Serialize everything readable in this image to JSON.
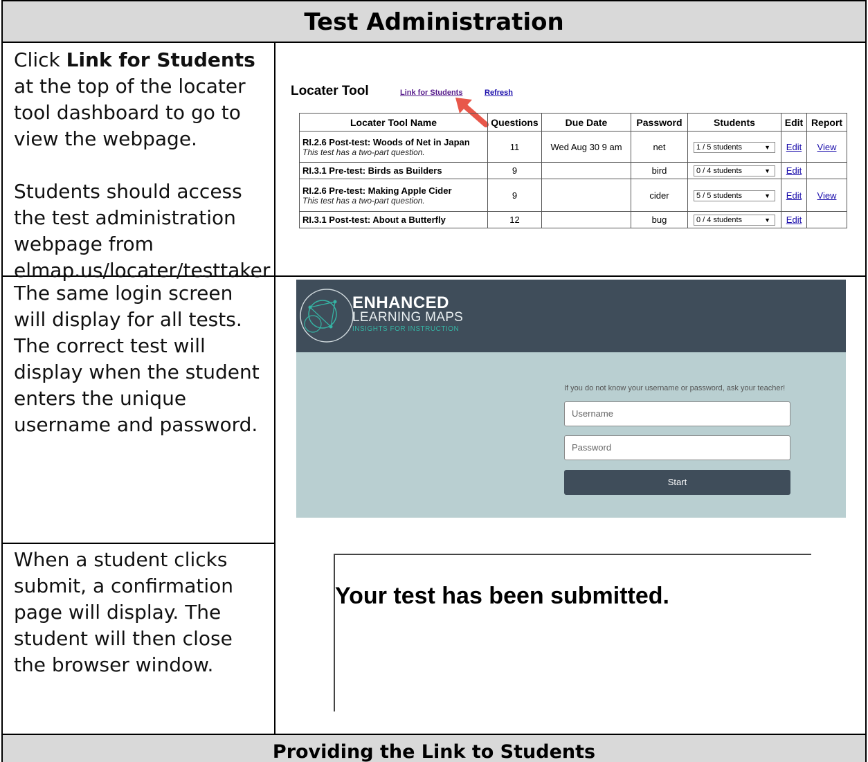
{
  "header": {
    "title": "Test Administration"
  },
  "footer": {
    "title": "Providing the Link to Students"
  },
  "row1": {
    "click_prefix": "Click ",
    "link_bold": "Link for Students",
    "text_a": "at the top of the locater tool dashboard to go to view the webpage.",
    "text_b": "Students should access the test administration webpage from elmap.us/locater/testtaker"
  },
  "locater": {
    "title": "Locater Tool",
    "link_students": "Link for Students",
    "link_refresh": "Refresh",
    "columns": [
      "Locater Tool Name",
      "Questions",
      "Due Date",
      "Password",
      "Students",
      "Edit",
      "Report"
    ],
    "rows": [
      {
        "name": "RI.2.6 Post-test: Woods of Net in Japan",
        "note": "This test has a two-part question.",
        "questions": "11",
        "due": "Wed Aug 30   9 am",
        "password": "net",
        "students": "1 / 5 students",
        "edit": "Edit",
        "report": "View"
      },
      {
        "name": "RI.3.1 Pre-test: Birds as Builders",
        "note": "",
        "questions": "9",
        "due": "",
        "password": "bird",
        "students": "0 / 4 students",
        "edit": "Edit",
        "report": ""
      },
      {
        "name": "RI.2.6 Pre-test: Making Apple Cider",
        "note": "This test has a two-part question.",
        "questions": "9",
        "due": "",
        "password": "cider",
        "students": "5 / 5 students",
        "edit": "Edit",
        "report": "View"
      },
      {
        "name": "RI.3.1 Post-test: About a Butterfly",
        "note": "",
        "questions": "12",
        "due": "",
        "password": "bug",
        "students": "0 / 4 students",
        "edit": "Edit",
        "report": ""
      }
    ],
    "arrow_color": "#e8574a"
  },
  "row2": {
    "text": "The same login screen will display for all tests. The correct test will display when the student enters the unique username and password."
  },
  "login": {
    "logo_line1": "ENHANCED",
    "logo_line2": "LEARNING MAPS",
    "logo_line3": "INSIGHTS FOR INSTRUCTION",
    "hint": "If you do not know your username or password, ask your teacher!",
    "username_placeholder": "Username",
    "password_placeholder": "Password",
    "start_label": "Start",
    "header_color": "#3f4d5a",
    "body_color": "#b9cfd1",
    "accent_color": "#35b4a4"
  },
  "row3": {
    "text": "When a student clicks submit, a confirmation page will display. The student will then close the browser window."
  },
  "submitted": {
    "message": "Your test has been submitted."
  }
}
